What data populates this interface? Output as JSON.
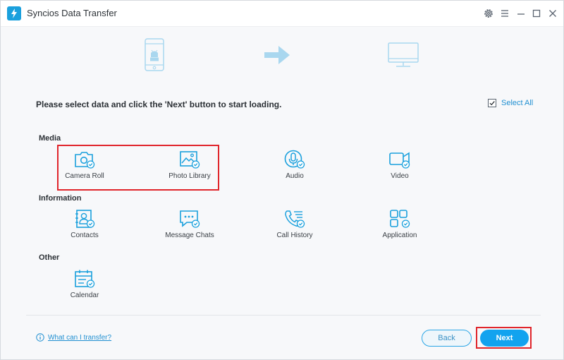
{
  "app": {
    "title": "Syncios Data Transfer"
  },
  "colors": {
    "accent": "#12a3ef",
    "icon": "#1aa0dd",
    "highlight": "#e0252b"
  },
  "titlebar_icons": [
    "gear-icon",
    "menu-icon",
    "minimize-icon",
    "maximize-icon",
    "close-icon"
  ],
  "instruction": "Please select data and click the 'Next' button to start loading.",
  "select_all": {
    "label": "Select All",
    "checked": true
  },
  "sections": [
    {
      "label": "Media",
      "items": [
        {
          "label": "Camera Roll",
          "icon": "camera-icon",
          "checked": true
        },
        {
          "label": "Photo Library",
          "icon": "image-icon",
          "checked": true
        },
        {
          "label": "Audio",
          "icon": "microphone-icon",
          "checked": true
        },
        {
          "label": "Video",
          "icon": "video-camera-icon",
          "checked": true
        }
      ]
    },
    {
      "label": "Information",
      "items": [
        {
          "label": "Contacts",
          "icon": "contact-card-icon",
          "checked": true
        },
        {
          "label": "Message Chats",
          "icon": "chat-bubble-icon",
          "checked": true
        },
        {
          "label": "Call History",
          "icon": "phone-list-icon",
          "checked": true
        },
        {
          "label": "Application",
          "icon": "app-grid-icon",
          "checked": true
        }
      ]
    },
    {
      "label": "Other",
      "items": [
        {
          "label": "Calendar",
          "icon": "calendar-icon",
          "checked": true
        }
      ]
    }
  ],
  "footer": {
    "help_link": "What can I transfer?",
    "back_label": "Back",
    "next_label": "Next"
  }
}
